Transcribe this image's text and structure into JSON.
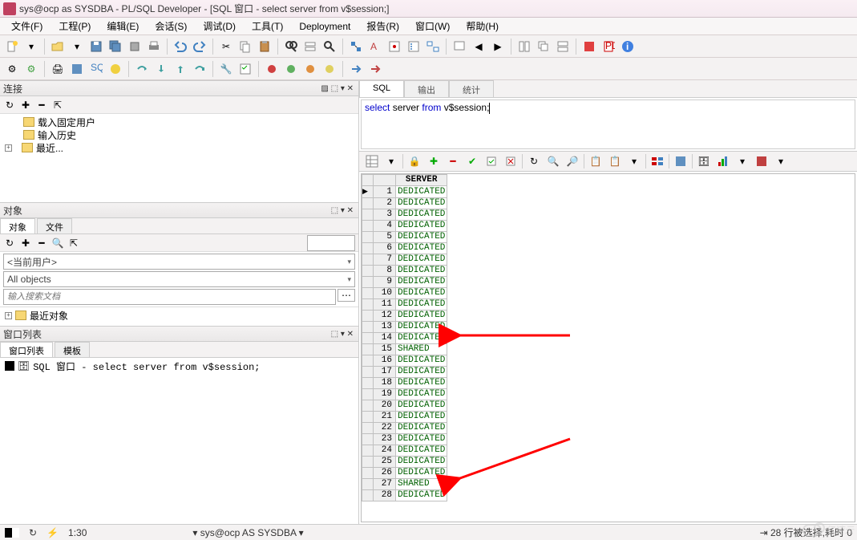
{
  "titlebar": {
    "text": "sys@ocp as SYSDBA - PL/SQL Developer - [SQL 窗口 - select server from v$session;]"
  },
  "menu": {
    "items": [
      "文件(F)",
      "工程(P)",
      "编辑(E)",
      "会话(S)",
      "调试(D)",
      "工具(T)",
      "Deployment",
      "报告(R)",
      "窗口(W)",
      "帮助(H)"
    ]
  },
  "left": {
    "connect_title": "连接",
    "tree": [
      {
        "label": "载入固定用户",
        "expandable": false
      },
      {
        "label": "输入历史",
        "expandable": false
      },
      {
        "label": "最近...",
        "expandable": true
      }
    ],
    "objects_title": "对象",
    "objects_tabs": [
      "对象",
      "文件"
    ],
    "current_user": "<当前用户>",
    "all_objects": "All objects",
    "search_placeholder": "输入搜索文档",
    "recent_objects": "最近对象",
    "window_list_title": "窗口列表",
    "window_list_tabs": [
      "窗口列表",
      "模板"
    ],
    "window_item": "SQL 窗口 - select server from v$session;"
  },
  "sql": {
    "tabs": [
      "SQL",
      "输出",
      "统计"
    ],
    "query_kw": "select",
    "query_mid": " server ",
    "query_kw2": "from",
    "query_tail": " v$session;"
  },
  "grid": {
    "header": "SERVER",
    "rows": [
      {
        "n": 1,
        "v": "DEDICATED"
      },
      {
        "n": 2,
        "v": "DEDICATED"
      },
      {
        "n": 3,
        "v": "DEDICATED"
      },
      {
        "n": 4,
        "v": "DEDICATED"
      },
      {
        "n": 5,
        "v": "DEDICATED"
      },
      {
        "n": 6,
        "v": "DEDICATED"
      },
      {
        "n": 7,
        "v": "DEDICATED"
      },
      {
        "n": 8,
        "v": "DEDICATED"
      },
      {
        "n": 9,
        "v": "DEDICATED"
      },
      {
        "n": 10,
        "v": "DEDICATED"
      },
      {
        "n": 11,
        "v": "DEDICATED"
      },
      {
        "n": 12,
        "v": "DEDICATED"
      },
      {
        "n": 13,
        "v": "DEDICATED"
      },
      {
        "n": 14,
        "v": "DEDICATED"
      },
      {
        "n": 15,
        "v": "SHARED"
      },
      {
        "n": 16,
        "v": "DEDICATED"
      },
      {
        "n": 17,
        "v": "DEDICATED"
      },
      {
        "n": 18,
        "v": "DEDICATED"
      },
      {
        "n": 19,
        "v": "DEDICATED"
      },
      {
        "n": 20,
        "v": "DEDICATED"
      },
      {
        "n": 21,
        "v": "DEDICATED"
      },
      {
        "n": 22,
        "v": "DEDICATED"
      },
      {
        "n": 23,
        "v": "DEDICATED"
      },
      {
        "n": 24,
        "v": "DEDICATED"
      },
      {
        "n": 25,
        "v": "DEDICATED"
      },
      {
        "n": 26,
        "v": "DEDICATED"
      },
      {
        "n": 27,
        "v": "SHARED"
      },
      {
        "n": 28,
        "v": "DEDICATED"
      }
    ]
  },
  "status": {
    "time": "1:30",
    "conn": "sys@ocp AS SYSDBA",
    "rows": "28 行被选择,耗时 0"
  },
  "watermark": "亿速云"
}
